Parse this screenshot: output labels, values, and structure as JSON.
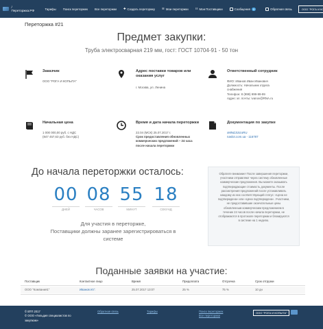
{
  "nav": {
    "brand": "/ Переторжка.РФ",
    "items": [
      "Тарифы",
      "Поиск переторжек",
      "Все переторжки",
      "Создать переторжку",
      "Мои переторжки",
      "Мои Поставщики"
    ],
    "messages_label": "Сообщения",
    "messages_count": "9",
    "feedback": "Обратная связь",
    "company": "ООО \"РОГА И КОПЫТА\""
  },
  "page": {
    "title": "Переторжка #21",
    "heading": "Предмет закупки:",
    "subheading": "Труба электросварная 219 мм, гост: ГОСТ 10704-91 - 50 тон"
  },
  "info": {
    "customer_head": "Заказчик",
    "customer_body": "ООО \"РОГА И КОПЫТА\"",
    "address_head": "Адрес поставки товаров или оказания услуг",
    "address_body": "г. Москва, ул. Ленина",
    "responsible_head": "Ответственный сотрудник",
    "responsible_lines": [
      "ФИО: Иванов Иван Иванович",
      "Должность: Начальник отдела",
      "снабжения",
      "Телефон: 8 (999) 999-99-99",
      "Адрес эл. почты: ivanov@RNA.ru"
    ],
    "price_head": "Начальная цена",
    "price_lines": [
      "1 000 000,00 руб. с НДС",
      "(847 457,63 руб. без НДС)"
    ],
    "time_head": "Время и дата начала переторжки",
    "time_date": "22.04 (МСК) 25.07.2017 г.",
    "time_note": [
      "Срок предоставления обновленных",
      "коммерческих предложений – 24 часа",
      "после начала переторжки"
    ],
    "docs_head": "Документация по закупке",
    "docs_links": [
      "xMNdJ15zoRU",
      "naslot.com.ua - 116787"
    ]
  },
  "countdown": {
    "title": "До начала переторжки осталось:",
    "units": [
      {
        "value": "00",
        "label": "ДНЕЙ"
      },
      {
        "value": "08",
        "label": "ЧАСОВ"
      },
      {
        "value": "55",
        "label": "МИНУТ"
      },
      {
        "value": "18",
        "label": "СЕКУНД"
      }
    ],
    "note_line1": "Для участия в переторжке,",
    "note_line2": "Поставщики должны заранее зарегистрироваться в",
    "note_line3": "системе"
  },
  "notice": {
    "lines": [
      "Обратите внимание! После завершения переторжки,",
      "участники отправляют через систему обновленные",
      "коммерческие предложения. Вы можете оказывать",
      "подтверждающие стоимость документы. После",
      "рассмотрения предложений после устанавливать",
      "каждому из них соответствующий статус: «Цена не",
      "подтверждена» или «Цена подтверждена». Участники,",
      "не предоставившие окончательные цены",
      "обновленным коммерческим предложением в",
      "течение 24 часов после начала переторжки, не",
      "отображаются в протоколе переторжки и блокируются",
      "в системе на 1 неделю."
    ]
  },
  "bids": {
    "title": "Поданные заявки на участие:",
    "columns": [
      "Поставщик",
      "Контактное лицо",
      "Время",
      "Предоплата",
      "Отсрочка",
      "Срок отгрузки"
    ],
    "rows": [
      [
        "ООО \"Компания1\"",
        "Иванов И.Г.",
        "25.07.2017 13:07",
        "25 %",
        "75 %",
        "10 дн"
      ]
    ]
  },
  "footer": {
    "copyright": "© ВТП 2017",
    "org_line1": "© ООО «Гильдия специалистов по",
    "org_line2": "закупкам»",
    "feedback": "Обратная связь",
    "tariffs": "Тарифы",
    "search": "Поиск переторжек",
    "all": "Все переторжки",
    "company": "ООО \"РОГА И КОПЫТА\""
  }
}
